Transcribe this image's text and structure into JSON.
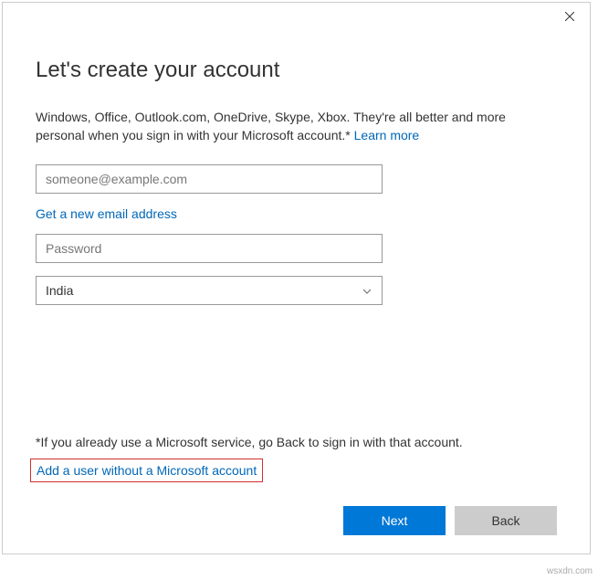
{
  "dialog": {
    "title": "Let's create your account",
    "description": "Windows, Office, Outlook.com, OneDrive, Skype, Xbox. They're all better and more personal when you sign in with your Microsoft account.* ",
    "learn_more_label": "Learn more",
    "email_placeholder": "someone@example.com",
    "get_email_label": "Get a new email address",
    "password_placeholder": "Password",
    "country_selected": "India",
    "footnote": "*If you already use a Microsoft service, go Back to sign in with that account.",
    "add_user_label": "Add a user without a Microsoft account",
    "next_label": "Next",
    "back_label": "Back"
  },
  "watermark": "wsxdn.com"
}
